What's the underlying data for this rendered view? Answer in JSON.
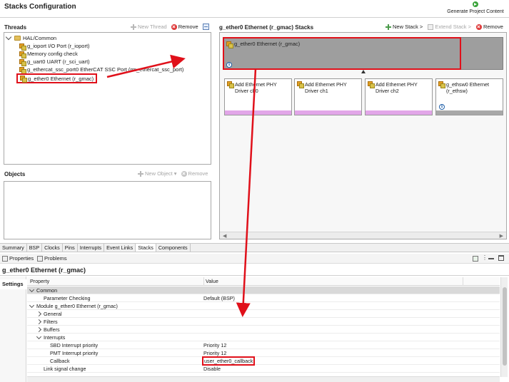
{
  "header": {
    "title": "Stacks Configuration",
    "generate_label": "Generate Project Content"
  },
  "threads": {
    "title": "Threads",
    "new_thread_label": "New Thread",
    "remove_label": "Remove",
    "tree": [
      {
        "label": "HAL/Common"
      },
      {
        "label": "g_ioport I/O Port (r_ioport)"
      },
      {
        "label": "Memory config check"
      },
      {
        "label": "g_uart0 UART (r_sci_uart)"
      },
      {
        "label": "g_ethercat_ssc_port0 EtherCAT SSC Port (rm_ethercat_ssc_port)"
      },
      {
        "label": "g_ether0 Ethernet (r_gmac)"
      }
    ]
  },
  "objects": {
    "title": "Objects",
    "new_object_label": "New Object",
    "remove_label": "Remove"
  },
  "stacks": {
    "title": "g_ether0 Ethernet (r_gmac) Stacks",
    "new_stack_label": "New Stack >",
    "extend_stack_label": "Extend Stack >",
    "remove_label": "Remove",
    "top_module": "g_ether0 Ethernet (r_gmac)",
    "children": [
      {
        "line1": "Add Ethernet PHY",
        "line2": "Driver ch0"
      },
      {
        "line1": "Add Ethernet PHY",
        "line2": "Driver ch1"
      },
      {
        "line1": "Add Ethernet PHY",
        "line2": "Driver ch2"
      },
      {
        "line1": "g_ethsw0 Ethernet",
        "line2": "(r_ethsw)"
      }
    ]
  },
  "config_tabs": [
    "Summary",
    "BSP",
    "Clocks",
    "Pins",
    "Interrupts",
    "Event Links",
    "Stacks",
    "Components"
  ],
  "props": {
    "properties_tab": "Properties",
    "problems_tab": "Problems",
    "title": "g_ether0 Ethernet (r_gmac)",
    "settings_label": "Settings",
    "col_property": "Property",
    "col_value": "Value",
    "rows": [
      {
        "name": "Common",
        "value": ""
      },
      {
        "name": "Parameter Checking",
        "value": "Default (BSP)"
      },
      {
        "name": "Module g_ether0 Ethernet (r_gmac)",
        "value": ""
      },
      {
        "name": "General",
        "value": ""
      },
      {
        "name": "Filters",
        "value": ""
      },
      {
        "name": "Buffers",
        "value": ""
      },
      {
        "name": "Interrupts",
        "value": ""
      },
      {
        "name": "SBD Interrupt priority",
        "value": "Priority 12"
      },
      {
        "name": "PMT Interrupt priority",
        "value": "Priority 12"
      },
      {
        "name": "Callback",
        "value": "user_ether0_callback"
      },
      {
        "name": "Link signal change",
        "value": "Disable"
      }
    ]
  },
  "colors": {
    "highlight": "#e0101a",
    "stack_selected": "#9e9e9e",
    "child_bar_pink": "#e2a6e8"
  }
}
